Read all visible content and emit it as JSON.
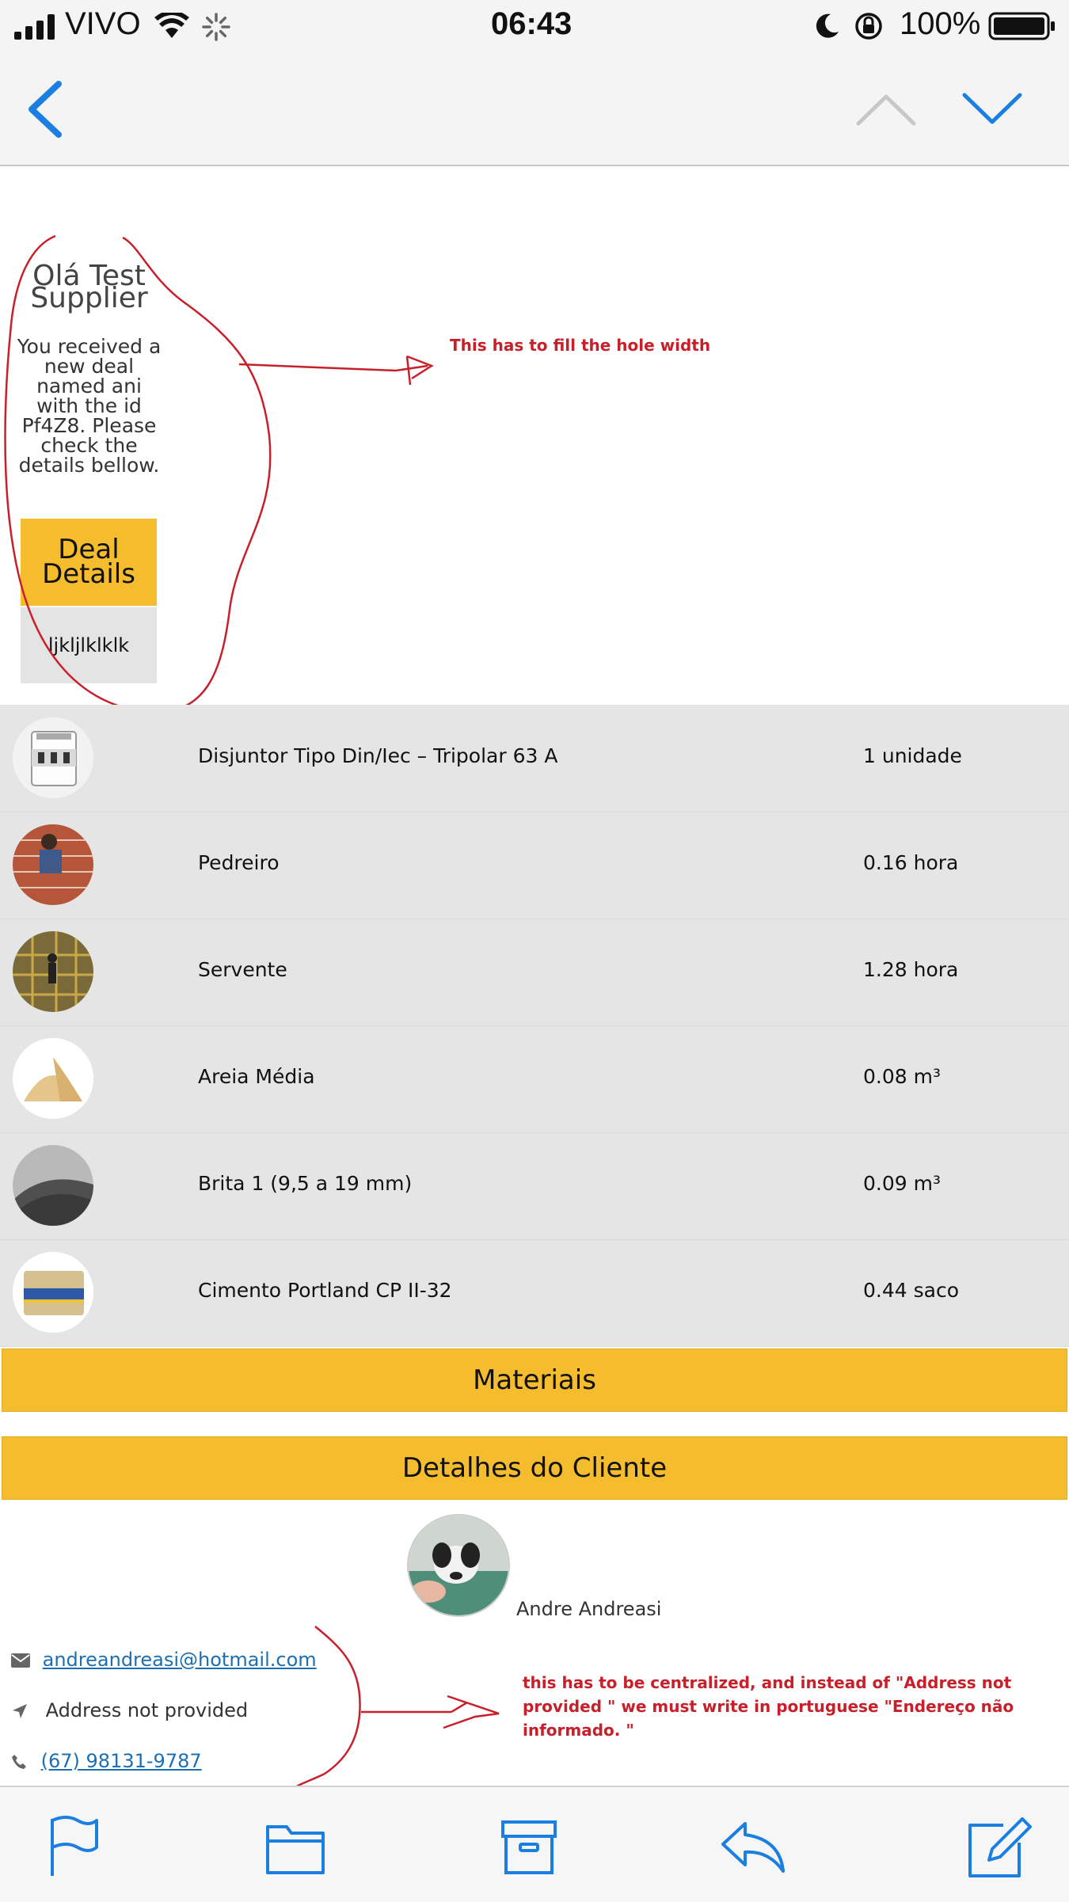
{
  "status_bar": {
    "carrier": "VIVO",
    "time": "06:43",
    "battery": "100%"
  },
  "nav": {
    "back_icon": "chevron-left-icon",
    "prev_icon": "chevron-up-icon",
    "next_icon": "chevron-down-icon"
  },
  "email": {
    "greeting": "Olá Test Supplier",
    "intro": "You received a new deal named ani with the id Pf4Z8. Please check the details bellow.",
    "deal_details_label": "Deal Details",
    "deal_code": "ljkljlklklk"
  },
  "annotations": {
    "top_note": "This has to fill the hole width",
    "bottom_note": "this has to be centralized, and instead of \"Address not provided  \" we must write in portuguese \"Endereço não informado. \""
  },
  "materials": [
    {
      "name": "Disjuntor Tipo Din/Iec – Tripolar 63 A",
      "qty": "1 unidade"
    },
    {
      "name": "Pedreiro",
      "qty": "0.16 hora"
    },
    {
      "name": "Servente",
      "qty": "1.28 hora"
    },
    {
      "name": "Areia Média",
      "qty": "0.08 m³"
    },
    {
      "name": "Brita 1 (9,5 a 19 mm)",
      "qty": "0.09 m³"
    },
    {
      "name": "Cimento Portland CP II-32",
      "qty": "0.44 saco"
    }
  ],
  "sections": {
    "materials_label": "Materiais",
    "client_label": "Detalhes do Cliente"
  },
  "client": {
    "name": "Andre Andreasi",
    "email": "andreandreasi@hotmail.com",
    "address": "Address not provided",
    "phone": "(67) 98131-9787"
  },
  "toolbar": {
    "icons": [
      "flag-icon",
      "folder-icon",
      "archive-icon",
      "reply-icon",
      "compose-icon"
    ]
  },
  "colors": {
    "accent_yellow": "#f5bd2e",
    "ios_blue": "#1a7fe0",
    "annotation_red": "#c8202a",
    "link_blue": "#1d6fb0"
  }
}
